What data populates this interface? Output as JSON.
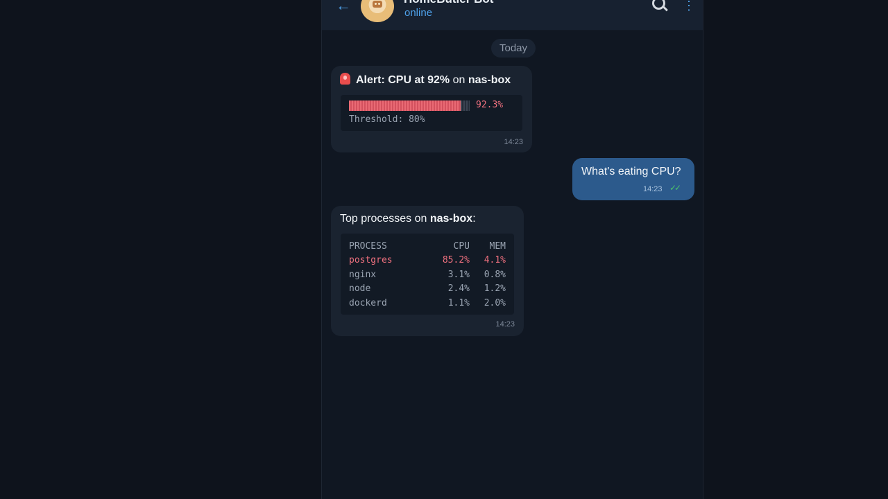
{
  "header": {
    "title": "HomeButler Bot",
    "status": "online",
    "back_icon": "arrow-left-icon",
    "search_icon": "search-icon",
    "more_icon": "more-vertical-icon"
  },
  "chat": {
    "date_chip": "Today",
    "alert": {
      "prefix": "Alert: CPU at 92%",
      "on": " on ",
      "host": "nas-box",
      "bar_fraction": 0.923,
      "bar_label": "92.3%",
      "threshold": "Threshold: 80%",
      "time": "14:23",
      "colors": {
        "bar": "#e96a74",
        "danger_text": "#f0717f"
      }
    },
    "outgoing": {
      "text": "What's eating CPU?",
      "time": "14:23",
      "status_icon": "double-check-icon"
    },
    "processes": {
      "prefix": "Top processes on ",
      "host": "nas-box",
      "suffix": ":",
      "headers": [
        "PROCESS",
        "CPU",
        "MEM"
      ],
      "rows": [
        [
          "postgres",
          "85.2%",
          "4.1%"
        ],
        [
          "nginx",
          "3.1%",
          "0.8%"
        ],
        [
          "node",
          "2.4%",
          "1.2%"
        ],
        [
          "dockerd",
          "1.1%",
          "2.0%"
        ]
      ],
      "time": "14:23"
    }
  }
}
